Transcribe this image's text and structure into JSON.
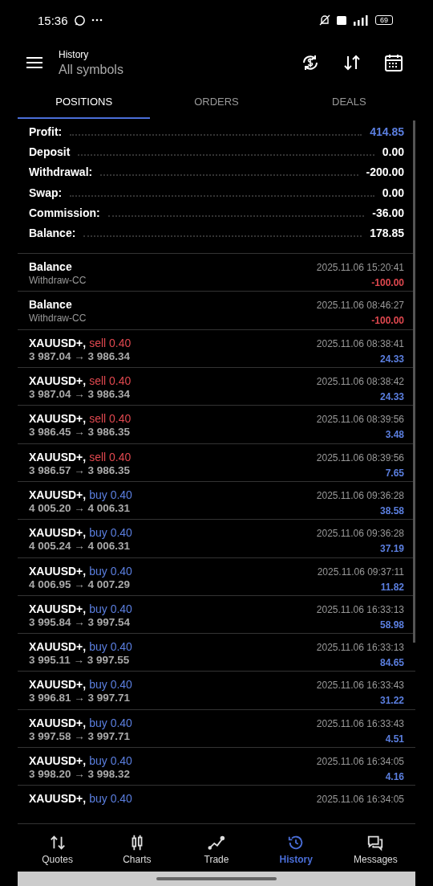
{
  "status_bar": {
    "time": "15:36",
    "battery": "69"
  },
  "header": {
    "title": "History",
    "subtitle": "All symbols"
  },
  "tabs": [
    {
      "label": "POSITIONS",
      "selected": true
    },
    {
      "label": "ORDERS",
      "selected": false
    },
    {
      "label": "DEALS",
      "selected": false
    }
  ],
  "summary": [
    {
      "label": "Profit:",
      "value": "414.85",
      "accent": true
    },
    {
      "label": "Deposit",
      "value": "0.00",
      "accent": false
    },
    {
      "label": "Withdrawal:",
      "value": "-200.00",
      "accent": false
    },
    {
      "label": "Swap:",
      "value": "0.00",
      "accent": false
    },
    {
      "label": "Commission:",
      "value": "-36.00",
      "accent": false
    },
    {
      "label": "Balance:",
      "value": "178.85",
      "accent": false
    }
  ],
  "rows": [
    {
      "kind": "balance",
      "title": "Balance",
      "subtitle": "Withdraw-CC",
      "time": "2025.11.06 15:20:41",
      "profit": "-100.00",
      "loss": true
    },
    {
      "kind": "balance",
      "title": "Balance",
      "subtitle": "Withdraw-CC",
      "time": "2025.11.06 08:46:27",
      "profit": "-100.00",
      "loss": true
    },
    {
      "kind": "sell",
      "title": "XAUUSD+,",
      "deal": "sell 0.40",
      "prices": "3 987.04 → 3 986.34",
      "time": "2025.11.06 08:38:41",
      "profit": "24.33",
      "loss": false
    },
    {
      "kind": "sell",
      "title": "XAUUSD+,",
      "deal": "sell 0.40",
      "prices": "3 987.04 → 3 986.34",
      "time": "2025.11.06 08:38:42",
      "profit": "24.33",
      "loss": false
    },
    {
      "kind": "sell",
      "title": "XAUUSD+,",
      "deal": "sell 0.40",
      "prices": "3 986.45 → 3 986.35",
      "time": "2025.11.06 08:39:56",
      "profit": "3.48",
      "loss": false
    },
    {
      "kind": "sell",
      "title": "XAUUSD+,",
      "deal": "sell 0.40",
      "prices": "3 986.57 → 3 986.35",
      "time": "2025.11.06 08:39:56",
      "profit": "7.65",
      "loss": false
    },
    {
      "kind": "buy",
      "title": "XAUUSD+,",
      "deal": "buy 0.40",
      "prices": "4 005.20 → 4 006.31",
      "time": "2025.11.06 09:36:28",
      "profit": "38.58",
      "loss": false
    },
    {
      "kind": "buy",
      "title": "XAUUSD+,",
      "deal": "buy 0.40",
      "prices": "4 005.24 → 4 006.31",
      "time": "2025.11.06 09:36:28",
      "profit": "37.19",
      "loss": false
    },
    {
      "kind": "buy",
      "title": "XAUUSD+,",
      "deal": "buy 0.40",
      "prices": "4 006.95 → 4 007.29",
      "time": "2025.11.06 09:37:11",
      "profit": "11.82",
      "loss": false
    },
    {
      "kind": "buy",
      "title": "XAUUSD+,",
      "deal": "buy 0.40",
      "prices": "3 995.84 → 3 997.54",
      "time": "2025.11.06 16:33:13",
      "profit": "58.98",
      "loss": false
    },
    {
      "kind": "buy",
      "title": "XAUUSD+,",
      "deal": "buy 0.40",
      "prices": "3 995.11 → 3 997.55",
      "time": "2025.11.06 16:33:13",
      "profit": "84.65",
      "loss": false
    },
    {
      "kind": "buy",
      "title": "XAUUSD+,",
      "deal": "buy 0.40",
      "prices": "3 996.81 → 3 997.71",
      "time": "2025.11.06 16:33:43",
      "profit": "31.22",
      "loss": false
    },
    {
      "kind": "buy",
      "title": "XAUUSD+,",
      "deal": "buy 0.40",
      "prices": "3 997.58 → 3 997.71",
      "time": "2025.11.06 16:33:43",
      "profit": "4.51",
      "loss": false
    },
    {
      "kind": "buy",
      "title": "XAUUSD+,",
      "deal": "buy 0.40",
      "prices": "3 998.20 → 3 998.32",
      "time": "2025.11.06 16:34:05",
      "profit": "4.16",
      "loss": false
    },
    {
      "kind": "buy",
      "title": "XAUUSD+,",
      "deal": "buy 0.40",
      "time": "2025.11.06 16:34:05"
    }
  ],
  "bottom_nav": [
    {
      "label": "Quotes",
      "selected": false
    },
    {
      "label": "Charts",
      "selected": false
    },
    {
      "label": "Trade",
      "selected": false
    },
    {
      "label": "History",
      "selected": true
    },
    {
      "label": "Messages",
      "selected": false
    }
  ]
}
